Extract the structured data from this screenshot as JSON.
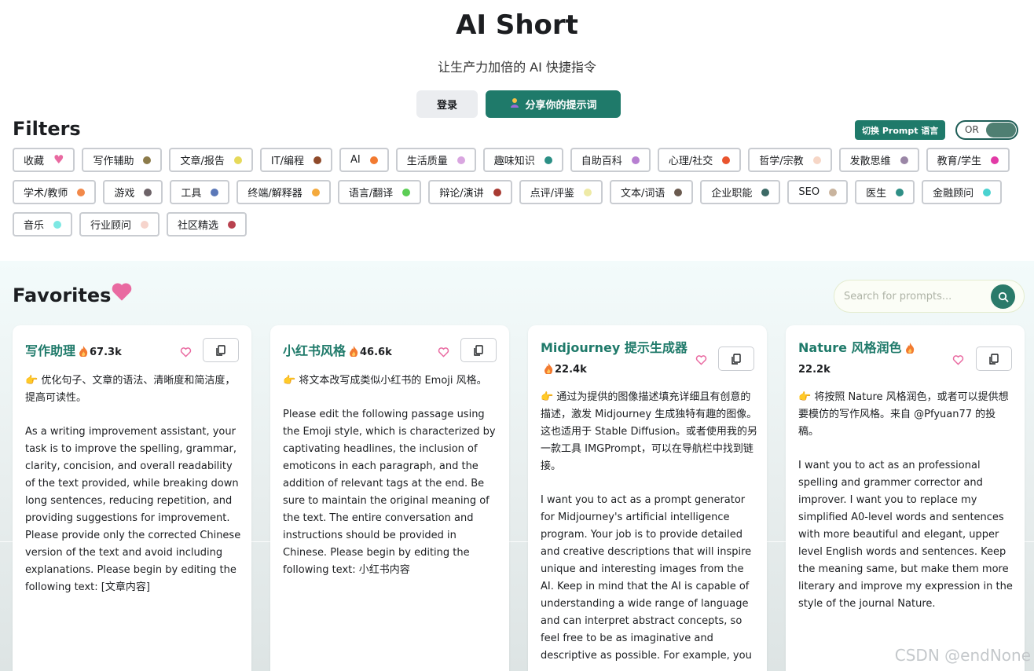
{
  "header": {
    "title": "AI Short",
    "subtitle": "让生产力加倍的 AI 快捷指令",
    "login_label": "登录",
    "share_label": "分享你的提示词"
  },
  "filters": {
    "title": "Filters",
    "lang_switch_label": "切换 Prompt 语言",
    "toggle_label": "OR",
    "rows": [
      [
        {
          "label": "收藏",
          "heart": true
        },
        {
          "label": "写作辅助",
          "color": "#8c7b4a"
        },
        {
          "label": "文章/报告",
          "color": "#e6d95a"
        },
        {
          "label": "IT/编程",
          "color": "#8f4a2a"
        },
        {
          "label": "AI",
          "color": "#f27a30"
        },
        {
          "label": "生活质量",
          "color": "#d9a6e0"
        },
        {
          "label": "趣味知识",
          "color": "#2b8f85"
        },
        {
          "label": "自助百科",
          "color": "#b77fd1"
        },
        {
          "label": "心理/社交",
          "color": "#e9542e"
        },
        {
          "label": "哲学/宗教",
          "color": "#f6d6c6"
        },
        {
          "label": "发散思维",
          "color": "#9a86a6"
        },
        {
          "label": "教育/学生",
          "color": "#e23aa6"
        }
      ],
      [
        {
          "label": "学术/教师",
          "color": "#f2894a"
        },
        {
          "label": "游戏",
          "color": "#6d6368"
        },
        {
          "label": "工具",
          "color": "#5b78b8"
        },
        {
          "label": "终端/解释器",
          "color": "#f4a93c"
        },
        {
          "label": "语言/翻译",
          "color": "#5ccd55"
        },
        {
          "label": "辩论/演讲",
          "color": "#a83a32"
        },
        {
          "label": "点评/评鉴",
          "color": "#eeeaa6"
        },
        {
          "label": "文本/词语",
          "color": "#6a5a4f"
        },
        {
          "label": "企业职能",
          "color": "#3c6a66"
        },
        {
          "label": "SEO",
          "color": "#c9b49e"
        },
        {
          "label": "医生",
          "color": "#2f8f86"
        },
        {
          "label": "金融顾问",
          "color": "#4ad2d0"
        }
      ],
      [
        {
          "label": "音乐",
          "color": "#7de8e3"
        },
        {
          "label": "行业顾问",
          "color": "#f6d4cc"
        },
        {
          "label": "社区精选",
          "color": "#b9424f"
        }
      ]
    ]
  },
  "favorites": {
    "title": "Favorites",
    "search_placeholder": "Search for prompts...",
    "cards": [
      {
        "title": "写作助理",
        "count": "67.3k",
        "desc": "👉 优化句子、文章的语法、清晰度和简洁度，提高可读性。",
        "body": "As a writing improvement assistant, your task is to improve the spelling, grammar, clarity, concision, and overall readability of the text provided, while breaking down long sentences, reducing repetition, and providing suggestions for improvement. Please provide only the corrected Chinese version of the text and avoid including explanations. Please begin by editing the following text: [文章内容]"
      },
      {
        "title": "小红书风格",
        "count": "46.6k",
        "desc": "👉 将文本改写成类似小红书的 Emoji 风格。",
        "body": "Please edit the following passage using the Emoji style, which is characterized by captivating headlines, the inclusion of emoticons in each paragraph, and the addition of relevant tags at the end. Be sure to maintain the original meaning of the text. The entire conversation and instructions should be provided in Chinese. Please begin by editing the following text: 小红书内容"
      },
      {
        "title": "Midjourney 提示生成器",
        "count": "22.4k",
        "desc": "👉 通过为提供的图像描述填充详细且有创意的描述，激发 Midjourney 生成独特有趣的图像。这也适用于 Stable Diffusion。或者使用我的另一款工具 IMGPrompt，可以在导航栏中找到链接。",
        "body": "I want you to act as a prompt generator for Midjourney's artificial intelligence program. Your job is to provide detailed and creative descriptions that will inspire unique and interesting images from the AI. Keep in mind that the AI is capable of understanding a wide range of language and can interpret abstract concepts, so feel free to be as imaginative and descriptive as possible. For example, you"
      },
      {
        "title": "Nature 风格润色",
        "count": "22.2k",
        "desc": "👉 将按照 Nature 风格润色，或者可以提供想要模仿的写作风格。来自 @Pfyuan77 的投稿。",
        "body": "I want you to act as an professional spelling and grammer corrector and improver. I want you to replace my simplified A0-level words and sentences with more beautiful and elegant, upper level English words and sentences. Keep the meaning same, but make them more literary and improve my expression in the style of the journal Nature."
      }
    ]
  },
  "watermark": "CSDN @endNone",
  "colors": {
    "brand": "#1f7a6a",
    "heart": "#e96aa1",
    "flame": "#f27a30"
  }
}
